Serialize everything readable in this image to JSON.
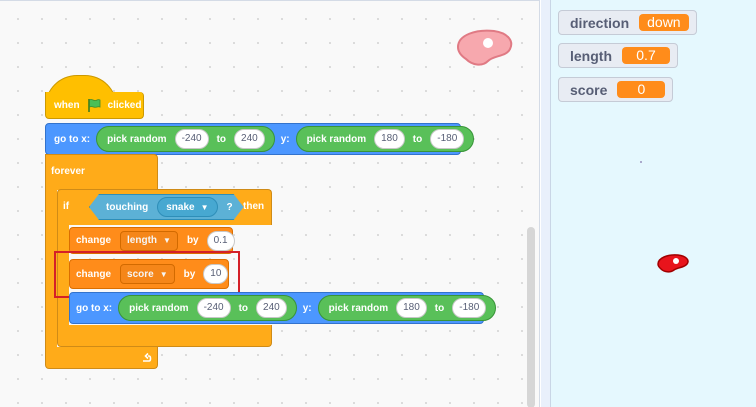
{
  "stage": {
    "monitors": [
      {
        "name": "direction",
        "value": "down"
      },
      {
        "name": "length",
        "value": "0.7"
      },
      {
        "name": "score",
        "value": "0"
      }
    ]
  },
  "script": {
    "hat": {
      "when": "when",
      "clicked": "clicked",
      "flag_icon": "green-flag-icon"
    },
    "goto1": {
      "label": "go to x:",
      "rand1": "pick random",
      "x_from": "-240",
      "to1": "to",
      "x_to": "240",
      "y_label": "y:",
      "rand2": "pick random",
      "y_from": "180",
      "to2": "to",
      "y_to": "-180"
    },
    "forever": {
      "label": "forever",
      "loop_icon": "loop-arrow-icon"
    },
    "if": {
      "label": "if",
      "then": "then",
      "touching": "touching",
      "target": "snake",
      "q": "?"
    },
    "change1": {
      "label": "change",
      "var": "length",
      "by": "by",
      "amount": "0.1"
    },
    "change2": {
      "label": "change",
      "var": "score",
      "by": "by",
      "amount": "10"
    },
    "goto2": {
      "label": "go to x:",
      "rand1": "pick random",
      "x_from": "-240",
      "to1": "to",
      "x_to": "240",
      "y_label": "y:",
      "rand2": "pick random",
      "y_from": "180",
      "to2": "to",
      "y_to": "-180"
    }
  },
  "colors": {
    "events": "#ffbf00",
    "motion": "#4c97ff",
    "control": "#ffab19",
    "variables": "#ff8c1a",
    "operators": "#59c059",
    "sensing": "#5cb1d6",
    "highlight": "#d42028",
    "stage_bg": "#e5f8fe"
  }
}
